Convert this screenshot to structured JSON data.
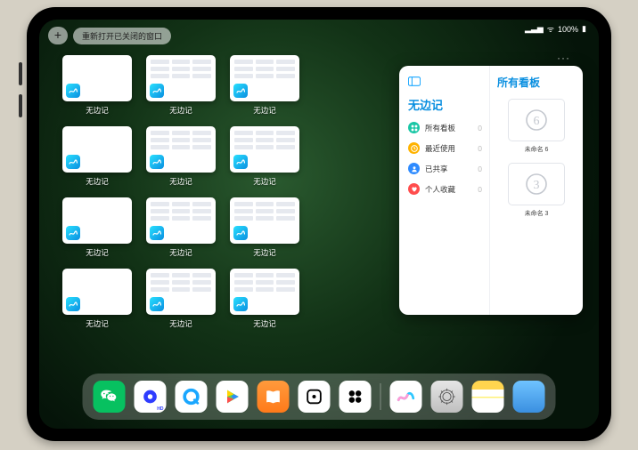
{
  "statusbar": {
    "wifi": "⋯",
    "battery": "100%"
  },
  "topbar": {
    "add_label": "+",
    "reopen_label": "重新打开已关闭的窗口"
  },
  "app_name": "无边记",
  "grid": {
    "tiles": [
      {
        "label": "无边记",
        "blank": true
      },
      {
        "label": "无边记",
        "blank": false
      },
      {
        "label": "无边记",
        "blank": false
      },
      {
        "label": "无边记",
        "blank": true
      },
      {
        "label": "无边记",
        "blank": false
      },
      {
        "label": "无边记",
        "blank": false
      },
      {
        "label": "无边记",
        "blank": true
      },
      {
        "label": "无边记",
        "blank": false
      },
      {
        "label": "无边记",
        "blank": false
      },
      {
        "label": "无边记",
        "blank": true
      },
      {
        "label": "无边记",
        "blank": false
      },
      {
        "label": "无边记",
        "blank": false
      }
    ]
  },
  "panel": {
    "more": "···",
    "title": "无边记",
    "right_title": "所有看板",
    "items": [
      {
        "icon": "grid",
        "color": "#1ac7a6",
        "label": "所有看板",
        "count": "0"
      },
      {
        "icon": "clock",
        "color": "#ffb300",
        "label": "最近使用",
        "count": "0"
      },
      {
        "icon": "share",
        "color": "#2e8bff",
        "label": "已共享",
        "count": "0"
      },
      {
        "icon": "heart",
        "color": "#ff4d4d",
        "label": "个人收藏",
        "count": "0"
      }
    ],
    "boards": [
      {
        "glyph": "6",
        "name": "未命名 6"
      },
      {
        "glyph": "3",
        "name": "未命名 3"
      }
    ]
  },
  "dock": {
    "apps": [
      {
        "name": "wechat"
      },
      {
        "name": "quark"
      },
      {
        "name": "qqbrowser"
      },
      {
        "name": "play"
      },
      {
        "name": "books"
      },
      {
        "name": "dice"
      },
      {
        "name": "shapes"
      }
    ],
    "recent": [
      {
        "name": "freeform"
      },
      {
        "name": "settings"
      },
      {
        "name": "notes"
      },
      {
        "name": "folder"
      }
    ]
  }
}
